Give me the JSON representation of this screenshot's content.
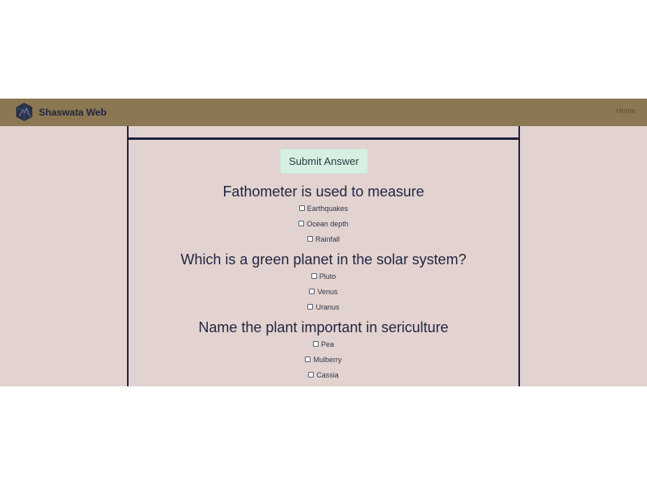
{
  "navbar": {
    "brand_name": "Shaswata Web",
    "home_label": "Home",
    "logo_icon": "hexagon-logo-icon"
  },
  "quiz": {
    "submit_label": "Submit Answer",
    "questions": [
      {
        "title": "Fathometer is used to measure",
        "options": [
          "Earthquakes",
          "Ocean depth",
          "Rainfall"
        ]
      },
      {
        "title": "Which is a green planet in the solar system?",
        "options": [
          "Pluto",
          "Venus",
          "Uranus"
        ]
      },
      {
        "title": "Name the plant important in sericulture",
        "options": [
          "Pea",
          "Mulberry",
          "Cassia"
        ]
      }
    ]
  },
  "colors": {
    "page_background": "#e3d3d0",
    "navbar_background": "#8b7752",
    "brand_text": "#1f2440",
    "submit_background": "#d7efe2"
  }
}
